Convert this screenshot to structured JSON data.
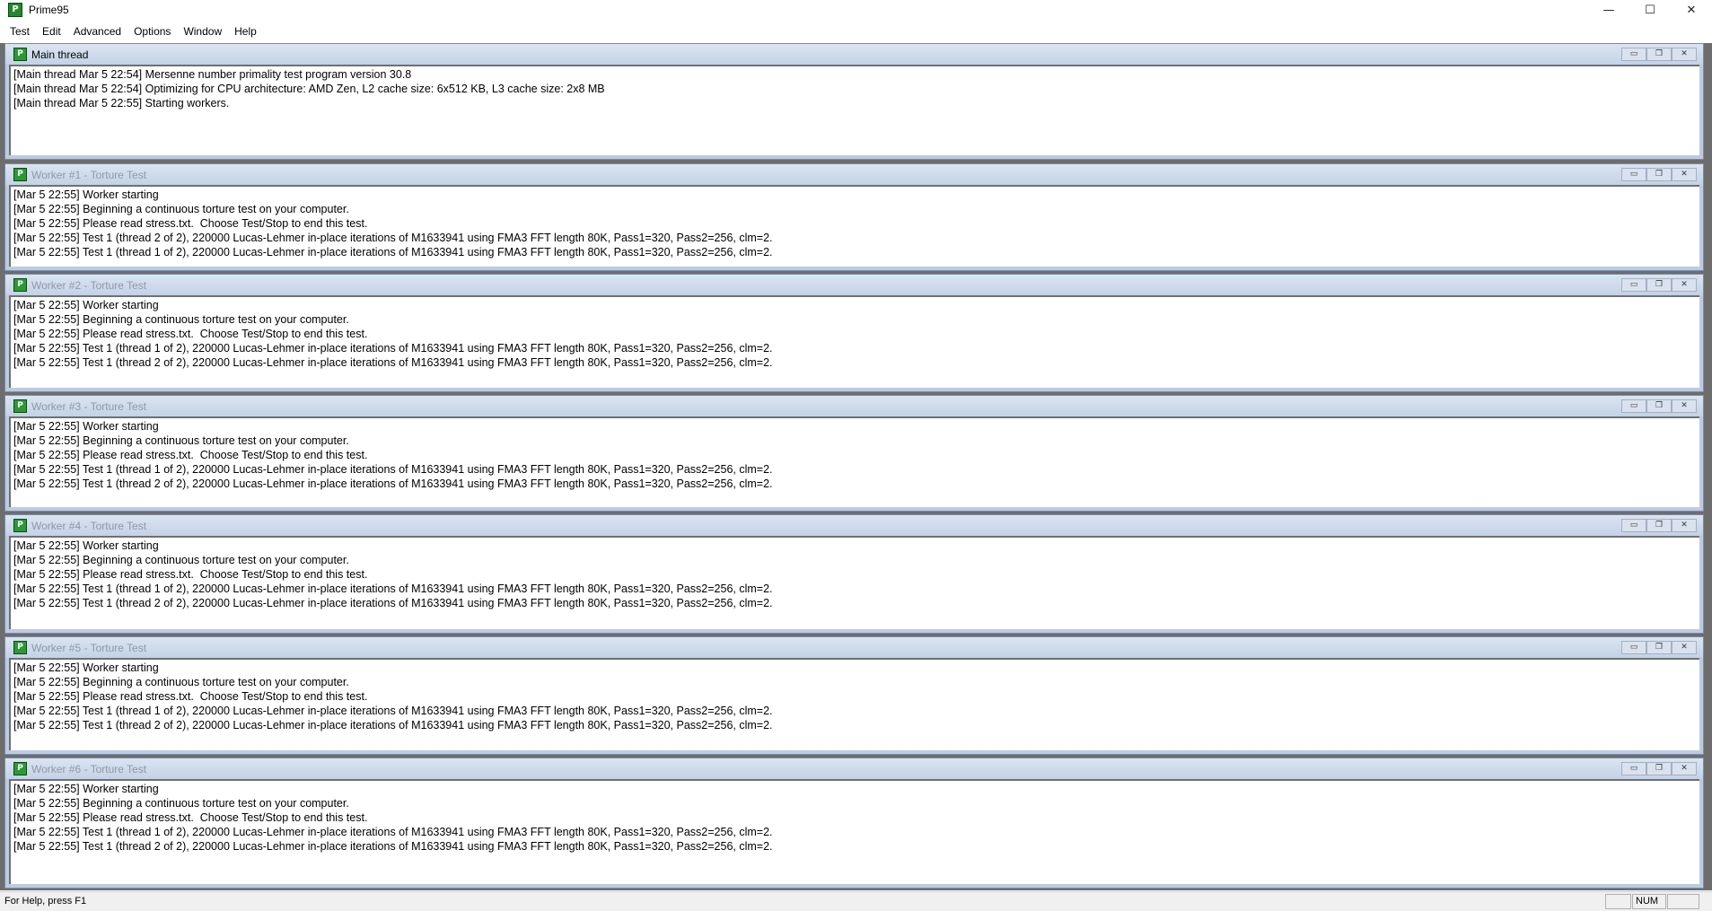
{
  "app": {
    "title": "Prime95"
  },
  "window_controls": {
    "minimize": "—",
    "maximize": "☐",
    "close": "✕"
  },
  "menu": [
    "Test",
    "Edit",
    "Advanced",
    "Options",
    "Window",
    "Help"
  ],
  "child_buttons": {
    "minimize": "▭",
    "restore": "❐",
    "close": "✕"
  },
  "windows": [
    {
      "title": "Main thread",
      "lines": [
        "[Main thread Mar 5 22:54] Mersenne number primality test program version 30.8",
        "[Main thread Mar 5 22:54] Optimizing for CPU architecture: AMD Zen, L2 cache size: 6x512 KB, L3 cache size: 2x8 MB",
        "[Main thread Mar 5 22:55] Starting workers."
      ]
    },
    {
      "title": "Worker #1 - Torture Test",
      "lines": [
        "[Mar 5 22:55] Worker starting",
        "[Mar 5 22:55] Beginning a continuous torture test on your computer.",
        "[Mar 5 22:55] Please read stress.txt.  Choose Test/Stop to end this test.",
        "[Mar 5 22:55] Test 1 (thread 2 of 2), 220000 Lucas-Lehmer in-place iterations of M1633941 using FMA3 FFT length 80K, Pass1=320, Pass2=256, clm=2.",
        "[Mar 5 22:55] Test 1 (thread 1 of 2), 220000 Lucas-Lehmer in-place iterations of M1633941 using FMA3 FFT length 80K, Pass1=320, Pass2=256, clm=2."
      ]
    },
    {
      "title": "Worker #2 - Torture Test",
      "lines": [
        "[Mar 5 22:55] Worker starting",
        "[Mar 5 22:55] Beginning a continuous torture test on your computer.",
        "[Mar 5 22:55] Please read stress.txt.  Choose Test/Stop to end this test.",
        "[Mar 5 22:55] Test 1 (thread 1 of 2), 220000 Lucas-Lehmer in-place iterations of M1633941 using FMA3 FFT length 80K, Pass1=320, Pass2=256, clm=2.",
        "[Mar 5 22:55] Test 1 (thread 2 of 2), 220000 Lucas-Lehmer in-place iterations of M1633941 using FMA3 FFT length 80K, Pass1=320, Pass2=256, clm=2."
      ]
    },
    {
      "title": "Worker #3 - Torture Test",
      "lines": [
        "[Mar 5 22:55] Worker starting",
        "[Mar 5 22:55] Beginning a continuous torture test on your computer.",
        "[Mar 5 22:55] Please read stress.txt.  Choose Test/Stop to end this test.",
        "[Mar 5 22:55] Test 1 (thread 1 of 2), 220000 Lucas-Lehmer in-place iterations of M1633941 using FMA3 FFT length 80K, Pass1=320, Pass2=256, clm=2.",
        "[Mar 5 22:55] Test 1 (thread 2 of 2), 220000 Lucas-Lehmer in-place iterations of M1633941 using FMA3 FFT length 80K, Pass1=320, Pass2=256, clm=2."
      ]
    },
    {
      "title": "Worker #4 - Torture Test",
      "lines": [
        "[Mar 5 22:55] Worker starting",
        "[Mar 5 22:55] Beginning a continuous torture test on your computer.",
        "[Mar 5 22:55] Please read stress.txt.  Choose Test/Stop to end this test.",
        "[Mar 5 22:55] Test 1 (thread 1 of 2), 220000 Lucas-Lehmer in-place iterations of M1633941 using FMA3 FFT length 80K, Pass1=320, Pass2=256, clm=2.",
        "[Mar 5 22:55] Test 1 (thread 2 of 2), 220000 Lucas-Lehmer in-place iterations of M1633941 using FMA3 FFT length 80K, Pass1=320, Pass2=256, clm=2."
      ]
    },
    {
      "title": "Worker #5 - Torture Test",
      "lines": [
        "[Mar 5 22:55] Worker starting",
        "[Mar 5 22:55] Beginning a continuous torture test on your computer.",
        "[Mar 5 22:55] Please read stress.txt.  Choose Test/Stop to end this test.",
        "[Mar 5 22:55] Test 1 (thread 1 of 2), 220000 Lucas-Lehmer in-place iterations of M1633941 using FMA3 FFT length 80K, Pass1=320, Pass2=256, clm=2.",
        "[Mar 5 22:55] Test 1 (thread 2 of 2), 220000 Lucas-Lehmer in-place iterations of M1633941 using FMA3 FFT length 80K, Pass1=320, Pass2=256, clm=2."
      ]
    },
    {
      "title": "Worker #6 - Torture Test",
      "lines": [
        "[Mar 5 22:55] Worker starting",
        "[Mar 5 22:55] Beginning a continuous torture test on your computer.",
        "[Mar 5 22:55] Please read stress.txt.  Choose Test/Stop to end this test.",
        "[Mar 5 22:55] Test 1 (thread 1 of 2), 220000 Lucas-Lehmer in-place iterations of M1633941 using FMA3 FFT length 80K, Pass1=320, Pass2=256, clm=2.",
        "[Mar 5 22:55] Test 1 (thread 2 of 2), 220000 Lucas-Lehmer in-place iterations of M1633941 using FMA3 FFT length 80K, Pass1=320, Pass2=256, clm=2."
      ]
    }
  ],
  "status": {
    "help_text": "For Help, press F1",
    "num_lock": "NUM"
  }
}
